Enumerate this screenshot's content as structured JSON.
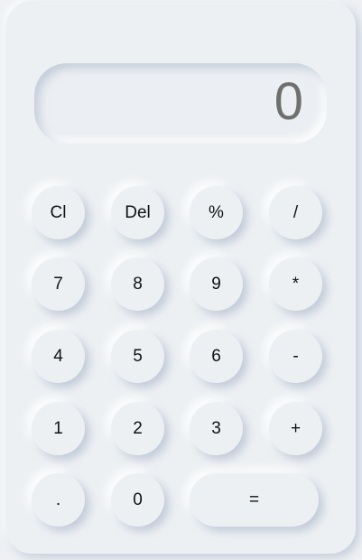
{
  "display": {
    "value": "0"
  },
  "keys": {
    "clear": "Cl",
    "delete": "Del",
    "percent": "%",
    "divide": "/",
    "seven": "7",
    "eight": "8",
    "nine": "9",
    "multiply": "*",
    "four": "4",
    "five": "5",
    "six": "6",
    "subtract": "-",
    "one": "1",
    "two": "2",
    "three": "3",
    "add": "+",
    "decimal": ".",
    "zero": "0",
    "equals": "="
  }
}
